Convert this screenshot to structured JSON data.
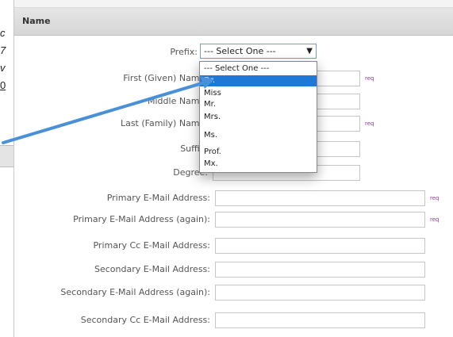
{
  "left_fragments": [
    "c",
    "7",
    "v",
    "0"
  ],
  "panel": {
    "title": "Name"
  },
  "prefix": {
    "label": "Prefix:",
    "selected": "--- Select One ---",
    "options": [
      "--- Select One ---",
      "Dr.",
      "Miss",
      "Mr.",
      "Mrs.",
      "Ms.",
      "Prof.",
      "Mx."
    ],
    "highlighted_index": 1
  },
  "required_marker": "req",
  "fields": [
    {
      "label": "First (Given) Name:",
      "value": "",
      "required": true
    },
    {
      "label": "Middle Name:",
      "value": "",
      "required": false
    },
    {
      "label": "Last (Family) Name:",
      "value": "",
      "required": true
    },
    {
      "label": "Suffix:",
      "value": "",
      "required": false
    },
    {
      "label": "Degree:",
      "value": "",
      "required": false
    },
    {
      "label": "Primary E-Mail Address:",
      "value": "",
      "required": true
    },
    {
      "label": "Primary E-Mail Address (again):",
      "value": "",
      "required": true
    },
    {
      "label": "Primary Cc E-Mail Address:",
      "value": "",
      "required": false
    },
    {
      "label": "Secondary E-Mail Address:",
      "value": "",
      "required": false
    },
    {
      "label": "Secondary E-Mail Address (again):",
      "value": "",
      "required": false
    },
    {
      "label": "Secondary Cc E-Mail Address:",
      "value": "",
      "required": false
    }
  ],
  "colors": {
    "accent": "#1e78d7",
    "arrow": "#4a90d9",
    "req": "#8a3c9c"
  }
}
